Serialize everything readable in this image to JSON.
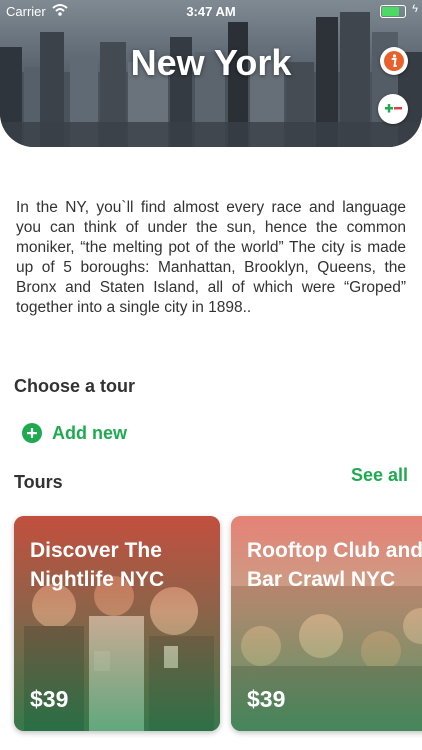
{
  "status_bar": {
    "carrier": "Carrier",
    "time": "3:47 AM",
    "battery_level": 0.8
  },
  "header": {
    "title": "New York",
    "info_icon": "info-icon",
    "zoom_icon": "zoom-toggle-icon"
  },
  "description": "In the NY, you`ll find almost every race and language you can think of under the sun, hence the common moniker, “the melting pot of the world”  The city is made up of 5 boroughs: Manhattan, Brooklyn, Queens, the Bronx and Staten Island, all of which were “Groped” together into a single city in 1898..",
  "choose_tour": {
    "title": "Choose a tour",
    "add_new_label": "Add new"
  },
  "tours": {
    "title": "Tours",
    "see_all_label": "See all",
    "items": [
      {
        "title": "Discover The Nightlife NYC",
        "price": "$39"
      },
      {
        "title": "Rooftop Club and Bar Crawl NYC",
        "price": "$39"
      }
    ]
  },
  "colors": {
    "accent_green": "#1faa52",
    "info_orange": "#e8612c",
    "text_dark": "#333333"
  }
}
